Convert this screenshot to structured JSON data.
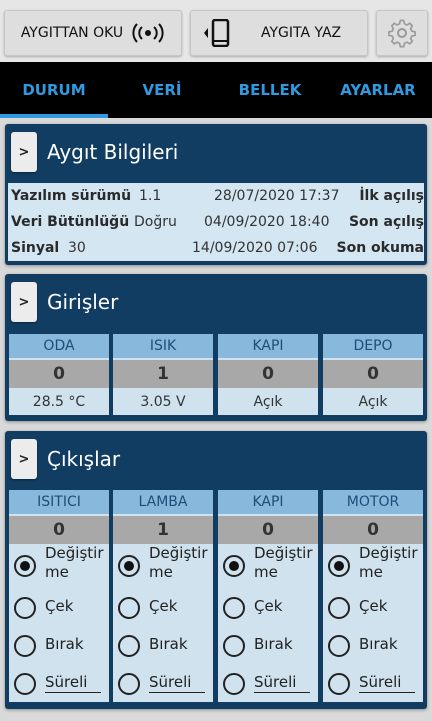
{
  "toolbar": {
    "read_label": "AYGITTAN OKU",
    "write_label": "AYGITA YAZ"
  },
  "tabs": [
    {
      "label": "DURUM",
      "active": true
    },
    {
      "label": "VERİ",
      "active": false
    },
    {
      "label": "BELLEK",
      "active": false
    },
    {
      "label": "AYARLAR",
      "active": false
    }
  ],
  "device_info": {
    "expand_label": ">",
    "title": "Aygıt Bilgileri",
    "rows": [
      {
        "key": "Yazılım sürümü",
        "value": "1.1",
        "datetime": "28/07/2020 17:37",
        "event": "İlk açılış"
      },
      {
        "key": "Veri Bütünlüğü",
        "value": "Doğru",
        "datetime": "04/09/2020 18:40",
        "event": "Son açılış"
      },
      {
        "key": "Sinyal",
        "value": "30",
        "datetime": "14/09/2020 07:06",
        "event": "Son okuma"
      }
    ]
  },
  "inputs": {
    "expand_label": ">",
    "title": "Girişler",
    "items": [
      {
        "name": "ODA",
        "value": "0",
        "detail": "28.5 °C"
      },
      {
        "name": "ISIK",
        "value": "1",
        "detail": "3.05 V"
      },
      {
        "name": "KAPI",
        "value": "0",
        "detail": "Açık"
      },
      {
        "name": "DEPO",
        "value": "0",
        "detail": "Açık"
      }
    ]
  },
  "outputs": {
    "expand_label": ">",
    "title": "Çıkışlar",
    "options": [
      "Değiştir\nme",
      "Çek",
      "Bırak",
      "Süreli"
    ],
    "items": [
      {
        "name": "ISITICI",
        "value": "0",
        "selected": "Değiştir\nme"
      },
      {
        "name": "LAMBA",
        "value": "1",
        "selected": "Değiştir\nme"
      },
      {
        "name": "KAPI",
        "value": "0",
        "selected": "Değiştir\nme"
      },
      {
        "name": "MOTOR",
        "value": "0",
        "selected": "Değiştir\nme"
      }
    ]
  },
  "colors": {
    "card_bg": "#123d62",
    "accent": "#2f9ae0",
    "column_header": "#88b9dc",
    "value_bg": "#a8a8a8"
  },
  "icons": [
    "wireless-signal-icon",
    "phone-icon",
    "gear-icon"
  ]
}
